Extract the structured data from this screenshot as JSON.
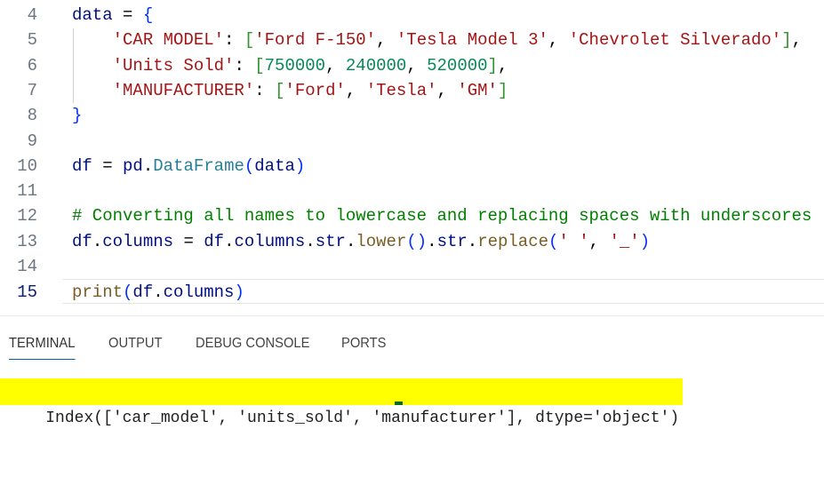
{
  "editor": {
    "lines": [
      {
        "n": "4",
        "tokens": [
          [
            "data",
            "t-var"
          ],
          [
            " = ",
            "t-op"
          ],
          [
            "{",
            "t-cb"
          ]
        ]
      },
      {
        "n": "5",
        "tokens": [
          [
            "    ",
            "t-op"
          ],
          [
            "'CAR MODEL'",
            "t-str"
          ],
          [
            ": ",
            "t-op"
          ],
          [
            "[",
            "t-br"
          ],
          [
            "'Ford F-150'",
            "t-str"
          ],
          [
            ", ",
            "t-op"
          ],
          [
            "'Tesla Model 3'",
            "t-str"
          ],
          [
            ", ",
            "t-op"
          ],
          [
            "'Chevrolet Silverado'",
            "t-str"
          ],
          [
            "]",
            "t-br"
          ],
          [
            ",",
            "t-op"
          ]
        ]
      },
      {
        "n": "6",
        "tokens": [
          [
            "    ",
            "t-op"
          ],
          [
            "'Units Sold'",
            "t-str"
          ],
          [
            ": ",
            "t-op"
          ],
          [
            "[",
            "t-br"
          ],
          [
            "750000",
            "t-num"
          ],
          [
            ", ",
            "t-op"
          ],
          [
            "240000",
            "t-num"
          ],
          [
            ", ",
            "t-op"
          ],
          [
            "520000",
            "t-num"
          ],
          [
            "]",
            "t-br"
          ],
          [
            ",",
            "t-op"
          ]
        ]
      },
      {
        "n": "7",
        "tokens": [
          [
            "    ",
            "t-op"
          ],
          [
            "'MANUFACTURER'",
            "t-str"
          ],
          [
            ": ",
            "t-op"
          ],
          [
            "[",
            "t-br"
          ],
          [
            "'Ford'",
            "t-str"
          ],
          [
            ", ",
            "t-op"
          ],
          [
            "'Tesla'",
            "t-str"
          ],
          [
            ", ",
            "t-op"
          ],
          [
            "'GM'",
            "t-str"
          ],
          [
            "]",
            "t-br"
          ]
        ]
      },
      {
        "n": "8",
        "tokens": [
          [
            "}",
            "t-cb"
          ]
        ]
      },
      {
        "n": "9",
        "tokens": []
      },
      {
        "n": "10",
        "tokens": [
          [
            "df",
            "t-var"
          ],
          [
            " = ",
            "t-op"
          ],
          [
            "pd",
            "t-var"
          ],
          [
            ".",
            "t-op"
          ],
          [
            "DataFrame",
            "t-cls"
          ],
          [
            "(",
            "t-par"
          ],
          [
            "data",
            "t-var"
          ],
          [
            ")",
            "t-par"
          ]
        ]
      },
      {
        "n": "11",
        "tokens": []
      },
      {
        "n": "12",
        "tokens": [
          [
            "# Converting all names to lowercase and replacing spaces with underscores",
            "t-cm"
          ]
        ]
      },
      {
        "n": "13",
        "tokens": [
          [
            "df",
            "t-var"
          ],
          [
            ".",
            "t-op"
          ],
          [
            "columns",
            "t-var"
          ],
          [
            " = ",
            "t-op"
          ],
          [
            "df",
            "t-var"
          ],
          [
            ".",
            "t-op"
          ],
          [
            "columns",
            "t-var"
          ],
          [
            ".",
            "t-op"
          ],
          [
            "str",
            "t-var"
          ],
          [
            ".",
            "t-op"
          ],
          [
            "lower",
            "t-fn"
          ],
          [
            "()",
            "t-par"
          ],
          [
            ".",
            "t-op"
          ],
          [
            "str",
            "t-var"
          ],
          [
            ".",
            "t-op"
          ],
          [
            "replace",
            "t-fn"
          ],
          [
            "(",
            "t-par"
          ],
          [
            "' '",
            "t-str"
          ],
          [
            ", ",
            "t-op"
          ],
          [
            "'_'",
            "t-str"
          ],
          [
            ")",
            "t-par"
          ]
        ]
      },
      {
        "n": "14",
        "tokens": []
      },
      {
        "n": "15",
        "tokens": [
          [
            "print",
            "t-fn"
          ],
          [
            "(",
            "t-par"
          ],
          [
            "df",
            "t-var"
          ],
          [
            ".",
            "t-op"
          ],
          [
            "columns",
            "t-var"
          ],
          [
            ")",
            "t-par"
          ]
        ]
      }
    ]
  },
  "panel": {
    "tabs": [
      "TERMINAL",
      "OUTPUT",
      "DEBUG CONSOLE",
      "PORTS"
    ],
    "active_tab": "TERMINAL",
    "output": "Index(['car_model', 'units_sold', 'manufacturer'], dtype='object')"
  },
  "colors": {
    "highlight": "#ffff00",
    "tab_underline": "#005fb8"
  }
}
